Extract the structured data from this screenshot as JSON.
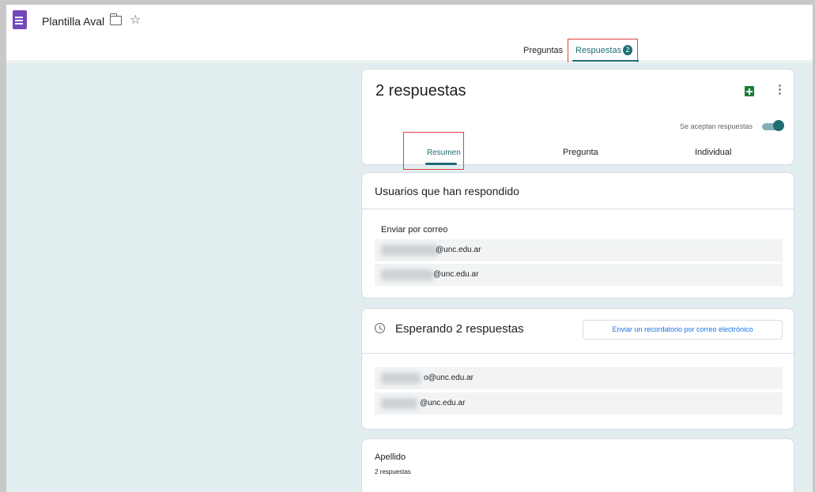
{
  "app": {
    "doc_title": "Plantilla Aval",
    "icon": "google-forms-icon"
  },
  "header": {
    "tabs": [
      {
        "label": "Preguntas",
        "active": false
      },
      {
        "label": "Respuestas",
        "active": true,
        "badge": "2"
      }
    ]
  },
  "summary_card": {
    "title": "2 respuestas",
    "accepting_label": "Se aceptan respuestas",
    "accepting_enabled": true,
    "subtabs": [
      {
        "label": "Resumen",
        "active": true
      },
      {
        "label": "Pregunta",
        "active": false
      },
      {
        "label": "Individual",
        "active": false
      }
    ]
  },
  "responded_card": {
    "heading": "Usuarios que han respondido",
    "sub_label": "Enviar por correo",
    "emails": [
      "@unc.edu.ar",
      "@unc.edu.ar"
    ]
  },
  "pending_card": {
    "heading": "Esperando 2 respuestas",
    "reminder_button": "Enviar un recordatorio por correo electrónico",
    "emails": [
      "o@unc.edu.ar",
      "@unc.edu.ar"
    ]
  },
  "question_card": {
    "title": "Apellido",
    "count": "2 respuestas"
  },
  "colors": {
    "accent": "#1e6d73",
    "forms_purple": "#7248b9",
    "sheets_green": "#188038",
    "background": "#e2edf0",
    "highlight": "#e04040"
  }
}
